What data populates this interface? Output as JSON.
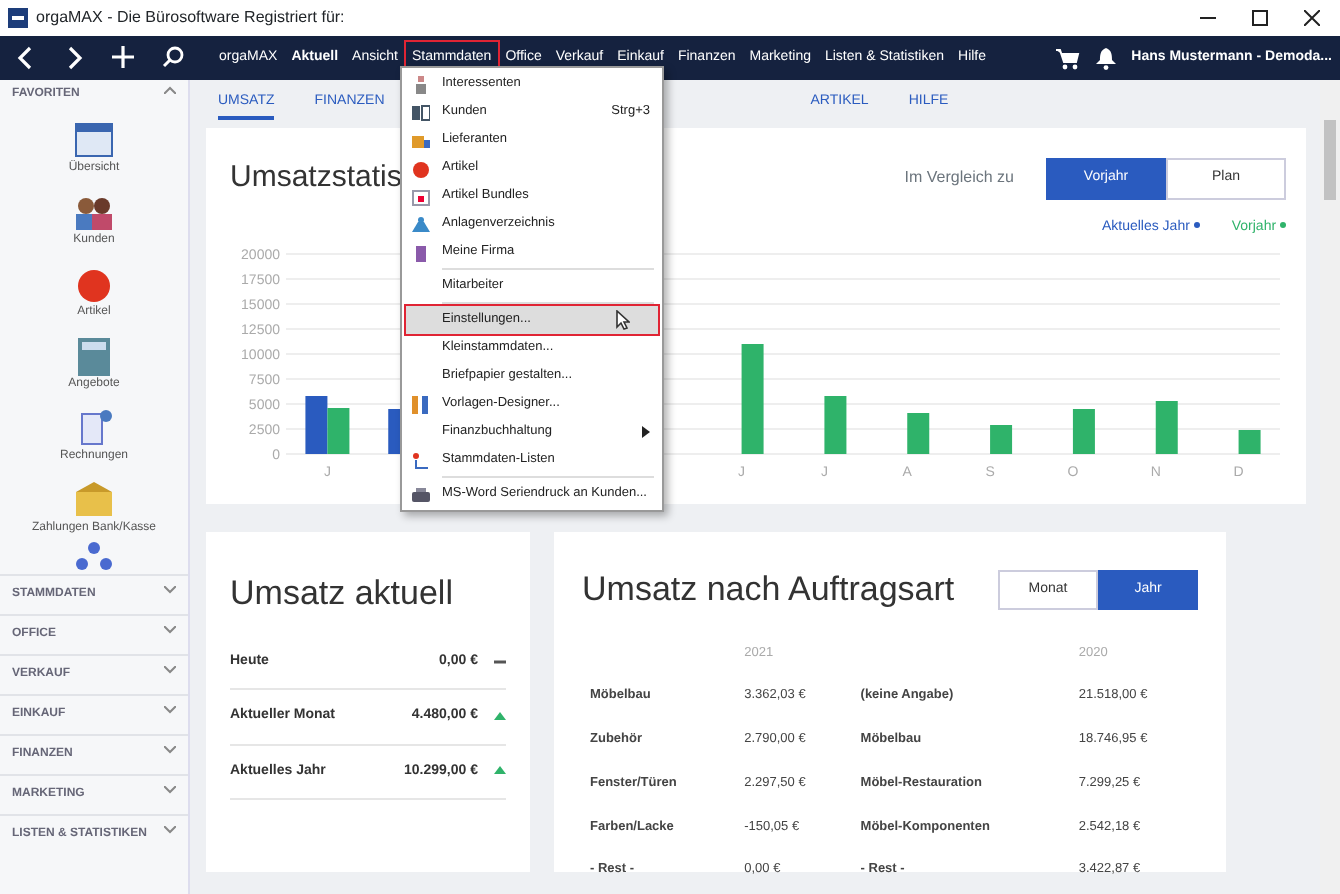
{
  "window": {
    "title": "orgaMAX - Die Bürosoftware Registriert für:"
  },
  "nav": {
    "items": [
      {
        "label": "orgaMAX",
        "selected": false
      },
      {
        "label": "Aktuell",
        "selected": true
      },
      {
        "label": "Ansicht",
        "selected": false
      },
      {
        "label": "Stammdaten",
        "selected": false,
        "highlighted": true
      },
      {
        "label": "Office",
        "selected": false
      },
      {
        "label": "Verkauf",
        "selected": false
      },
      {
        "label": "Einkauf",
        "selected": false
      },
      {
        "label": "Finanzen",
        "selected": false
      },
      {
        "label": "Marketing",
        "selected": false
      },
      {
        "label": "Listen & Statistiken",
        "selected": false
      },
      {
        "label": "Hilfe",
        "selected": false
      }
    ],
    "user": "Hans Mustermann - Demoda..."
  },
  "sidebar": {
    "header": "FAVORITEN",
    "favorites": [
      {
        "label": "Übersicht"
      },
      {
        "label": "Kunden"
      },
      {
        "label": "Artikel"
      },
      {
        "label": "Angebote"
      },
      {
        "label": "Rechnungen"
      },
      {
        "label": "Zahlungen Bank/Kasse"
      }
    ],
    "sections": [
      {
        "label": "STAMMDATEN",
        "expanded": false
      },
      {
        "label": "OFFICE",
        "expanded": false
      },
      {
        "label": "VERKAUF",
        "expanded": false
      },
      {
        "label": "EINKAUF",
        "expanded": false
      },
      {
        "label": "FINANZEN",
        "expanded": false
      },
      {
        "label": "MARKETING",
        "expanded": false
      },
      {
        "label": "LISTEN & STATISTIKEN",
        "expanded": false
      }
    ]
  },
  "tabs": [
    {
      "label": "UMSATZ",
      "selected": true
    },
    {
      "label": "FINANZEN",
      "selected": false
    },
    {
      "label": "ARTIKEL",
      "selected": false
    },
    {
      "label": "HILFE",
      "selected": false
    }
  ],
  "sales_chart": {
    "title": "Umsatzstatis",
    "compare_label": "Im Vergleich zu",
    "compare_options": [
      {
        "label": "Vorjahr",
        "selected": true
      },
      {
        "label": "Plan",
        "selected": false
      }
    ],
    "chart_data": {
      "type": "bar",
      "grid": true,
      "categories": [
        "J",
        null,
        null,
        null,
        null,
        "J",
        "J",
        "A",
        "S",
        "O",
        "N",
        "D"
      ],
      "yticks": [
        0,
        2500,
        5000,
        7500,
        10000,
        12500,
        15000,
        17500,
        20000
      ],
      "ylim": [
        0,
        20000
      ],
      "series": [
        {
          "name": "Aktuelles Jahr",
          "color": "#2a5bbf",
          "values": [
            5800,
            4500,
            null,
            null,
            null,
            null,
            null,
            null,
            null,
            null,
            null,
            null
          ]
        },
        {
          "name": "Vorjahr",
          "color": "#2fb36a",
          "values": [
            4600,
            null,
            null,
            null,
            null,
            11000,
            5800,
            4100,
            2900,
            4500,
            5300,
            2400
          ]
        }
      ]
    }
  },
  "current_sales": {
    "title": "Umsatz aktuell",
    "rows": [
      {
        "label": "Heute",
        "amount": "0,00 €",
        "kind": "flat"
      },
      {
        "label": "Aktueller Monat",
        "amount": "4.480,00 €",
        "kind": "up"
      },
      {
        "label": "Aktuelles Jahr",
        "amount": "10.299,00 €",
        "kind": "up"
      }
    ]
  },
  "sales_by_type": {
    "title": "Umsatz nach Auftragsart",
    "periods": [
      {
        "label": "Monat",
        "selected": false
      },
      {
        "label": "Jahr",
        "selected": true
      }
    ],
    "years": [
      "2021",
      "2020"
    ],
    "rows": [
      [
        "Möbelbau",
        "3.362,03 €",
        "(keine Angabe)",
        "21.518,00 €"
      ],
      [
        "Zubehör",
        "2.790,00 €",
        "Möbelbau",
        "18.746,95 €"
      ],
      [
        "Fenster/Türen",
        "2.297,50 €",
        "Möbel-Restauration",
        "7.299,25 €"
      ],
      [
        "Farben/Lacke",
        "-150,05 €",
        "Möbel-Komponenten",
        "2.542,18 €"
      ],
      [
        "- Rest -",
        "0,00 €",
        "- Rest -",
        "3.422,87 €"
      ]
    ]
  },
  "menu": {
    "items": [
      {
        "label": "Interessenten",
        "selected": false
      },
      {
        "label": "Kunden",
        "shortcut": "Strg+3",
        "selected": false
      },
      {
        "label": "Lieferanten",
        "selected": false
      },
      {
        "label": "Artikel",
        "selected": false
      },
      {
        "label": "Artikel Bundles",
        "selected": false
      },
      {
        "label": "Anlagenverzeichnis",
        "selected": false
      },
      {
        "label": "Meine Firma",
        "selected": false
      },
      {
        "label": "Mitarbeiter",
        "separator": true,
        "selected": false
      },
      {
        "label": "Einstellungen...",
        "separator": true,
        "selected": true
      },
      {
        "label": "Kleinstammdaten...",
        "selected": false
      },
      {
        "label": "Briefpapier gestalten...",
        "selected": false
      },
      {
        "label": "Vorlagen-Designer...",
        "selected": false
      },
      {
        "label": "Finanzbuchhaltung",
        "submenu": true,
        "selected": false
      },
      {
        "label": "Stammdaten-Listen",
        "selected": false
      },
      {
        "label": "MS-Word Seriendruck an Kunden...",
        "separator": true,
        "selected": false
      }
    ]
  }
}
